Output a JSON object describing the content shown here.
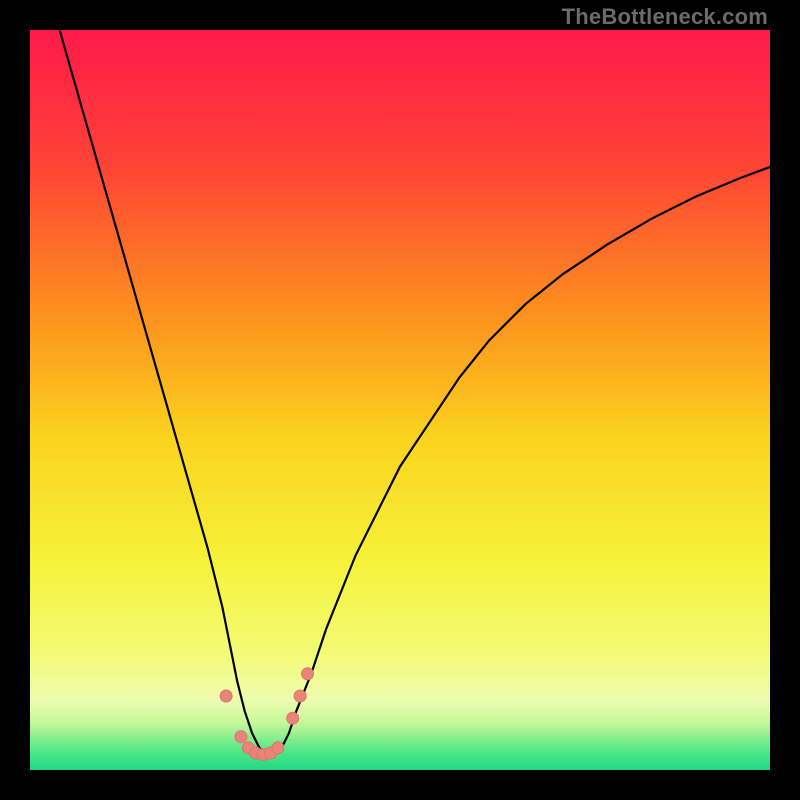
{
  "watermark": "TheBottleneck.com",
  "colors": {
    "background": "#000000",
    "curve_stroke": "#000000",
    "marker_fill": "#e9847b",
    "marker_stroke": "#e07266"
  },
  "chart_data": {
    "type": "line",
    "title": "",
    "xlabel": "",
    "ylabel": "",
    "xlim": [
      0,
      100
    ],
    "ylim": [
      0,
      100
    ],
    "gradient_note": "vertical rainbow: red→orange→yellow near top/mid, compressed green band at bottom",
    "gradient_stops": [
      {
        "offset": 0.0,
        "color": "#ff1a4b"
      },
      {
        "offset": 0.18,
        "color": "#ff4236"
      },
      {
        "offset": 0.38,
        "color": "#fe8f1e"
      },
      {
        "offset": 0.55,
        "color": "#fad31e"
      },
      {
        "offset": 0.72,
        "color": "#f6f23a"
      },
      {
        "offset": 0.85,
        "color": "#f3fb7a"
      },
      {
        "offset": 0.905,
        "color": "#eefcb0"
      },
      {
        "offset": 0.935,
        "color": "#c8f89a"
      },
      {
        "offset": 0.955,
        "color": "#8def8e"
      },
      {
        "offset": 0.975,
        "color": "#4fe788"
      },
      {
        "offset": 1.0,
        "color": "#1fd883"
      }
    ],
    "series": [
      {
        "name": "bottleneck-curve",
        "x": [
          4,
          6,
          8,
          10,
          12,
          14,
          16,
          18,
          20,
          22,
          24,
          26,
          27,
          28,
          29,
          30,
          31,
          32,
          33,
          34,
          35,
          36,
          38,
          40,
          42,
          44,
          47,
          50,
          54,
          58,
          62,
          67,
          72,
          78,
          84,
          90,
          96,
          100
        ],
        "y": [
          100,
          93,
          86,
          79,
          72,
          65,
          58,
          51,
          44,
          37,
          30,
          22,
          17,
          12,
          8,
          5,
          3,
          2,
          2,
          3,
          5,
          8,
          13,
          19,
          24,
          29,
          35,
          41,
          47,
          53,
          58,
          63,
          67,
          71,
          74.5,
          77.5,
          80,
          81.5
        ]
      }
    ],
    "markers": {
      "name": "highlight-points",
      "x": [
        26.5,
        28.5,
        29.5,
        30.5,
        31.5,
        32.5,
        33.5,
        35.5,
        36.5,
        37.5
      ],
      "y": [
        10,
        4.5,
        3,
        2.3,
        2.1,
        2.3,
        3,
        7,
        10,
        13
      ]
    }
  }
}
